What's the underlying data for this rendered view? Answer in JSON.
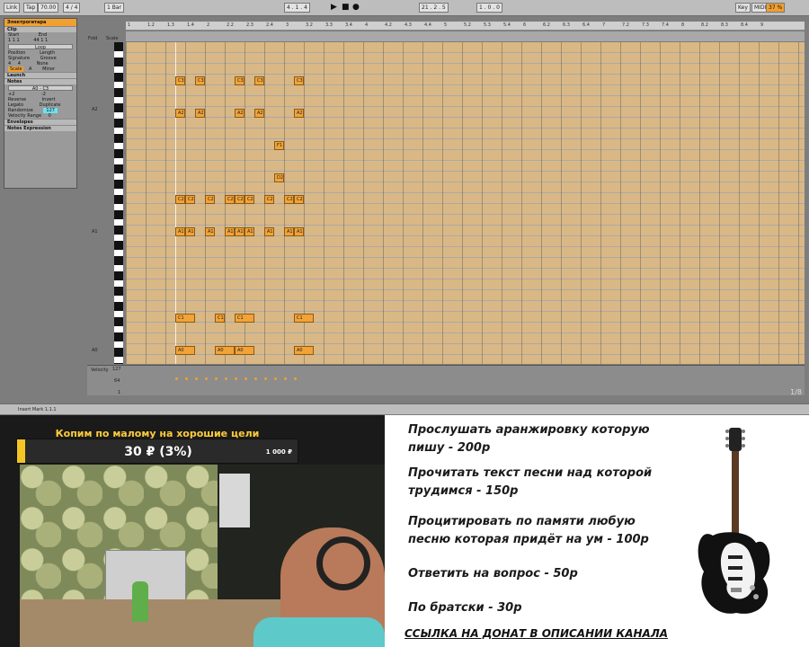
{
  "daw": {
    "transport": {
      "link": "Link",
      "tap": "Tap",
      "tempo": "70.00",
      "time_sig": "4 / 4",
      "quantize": "1 Bar",
      "position": "4 . 1 . 4",
      "loop_start": "21 . 2 . 5",
      "loop_length": "1 . 0 . 0",
      "key": "Key",
      "midi": "MIDI",
      "zoom": "37 %"
    },
    "clip_panel": {
      "clip_name": "Электрогитара",
      "sections": [
        "Clip",
        "Sample",
        "Launch",
        "Notes",
        "Envelopes",
        "Notes Expression"
      ],
      "fields": {
        "start": "Start",
        "end": "End",
        "loop": "Loop",
        "position": "Position",
        "length": "Length",
        "signature": "Signature",
        "groove": "Groove",
        "scale": "Scale",
        "scale_root": "A",
        "scale_mode": "Minor",
        "start_values": "1  1  1",
        "end_values": "44  1  1",
        "sig_num": "4",
        "sig_den": "4",
        "groove_value": "None",
        "note_range": "A0 - C3",
        "transpose_up": "+2",
        "transpose_down": "-2",
        "reverse": "Reverse",
        "invert": "Invert",
        "legato": "Legato",
        "duplicate": "Duplicate",
        "randomize": "Randomize",
        "randomize_value": "127",
        "velocity_range": "Velocity Range",
        "velocity_range_value": "0"
      }
    },
    "ruler_ticks": [
      "1",
      "1.2",
      "1.3",
      "1.4",
      "2",
      "2.2",
      "2.3",
      "2.4",
      "3",
      "3.2",
      "3.3",
      "3.4",
      "4",
      "4.2",
      "4.3",
      "4.4",
      "5",
      "5.2",
      "5.3",
      "5.4",
      "6",
      "6.2",
      "6.3",
      "6.4",
      "7",
      "7.2",
      "7.3",
      "7.4",
      "8",
      "8.2",
      "8.3",
      "8.4",
      "9"
    ],
    "fold_label": "Fold",
    "scale_label": "Scale",
    "octave_labels": [
      "A2",
      "A1",
      "A0"
    ],
    "notes": [
      {
        "label": "C3",
        "col": 0,
        "row": 3,
        "len": 1
      },
      {
        "label": "C3",
        "col": 1,
        "row": 3,
        "len": 1
      },
      {
        "label": "C3",
        "col": 3,
        "row": 3,
        "len": 1
      },
      {
        "label": "C3",
        "col": 4,
        "row": 3,
        "len": 1
      },
      {
        "label": "C3",
        "col": 6,
        "row": 3,
        "len": 1
      },
      {
        "label": "A2",
        "col": 0,
        "row": 6,
        "len": 1
      },
      {
        "label": "A2",
        "col": 1,
        "row": 6,
        "len": 1
      },
      {
        "label": "A2",
        "col": 3,
        "row": 6,
        "len": 1
      },
      {
        "label": "A2",
        "col": 4,
        "row": 6,
        "len": 1
      },
      {
        "label": "A2",
        "col": 6,
        "row": 6,
        "len": 1
      },
      {
        "label": "F1",
        "col": 5,
        "row": 9,
        "len": 1
      },
      {
        "label": "D2",
        "col": 5,
        "row": 12,
        "len": 1
      },
      {
        "label": "C2",
        "col": 0,
        "row": 14,
        "len": 1
      },
      {
        "label": "C2",
        "col": 0.5,
        "row": 14,
        "len": 1
      },
      {
        "label": "C2",
        "col": 1.5,
        "row": 14,
        "len": 1
      },
      {
        "label": "C2",
        "col": 2.5,
        "row": 14,
        "len": 1
      },
      {
        "label": "C2",
        "col": 3,
        "row": 14,
        "len": 1
      },
      {
        "label": "C2",
        "col": 3.5,
        "row": 14,
        "len": 1
      },
      {
        "label": "C2",
        "col": 4.5,
        "row": 14,
        "len": 1
      },
      {
        "label": "C2",
        "col": 5.5,
        "row": 14,
        "len": 1
      },
      {
        "label": "C2",
        "col": 6,
        "row": 14,
        "len": 1
      },
      {
        "label": "A1",
        "col": 0,
        "row": 17,
        "len": 1
      },
      {
        "label": "A1",
        "col": 0.5,
        "row": 17,
        "len": 1
      },
      {
        "label": "A1",
        "col": 1.5,
        "row": 17,
        "len": 1
      },
      {
        "label": "A1",
        "col": 2.5,
        "row": 17,
        "len": 1
      },
      {
        "label": "A1",
        "col": 3,
        "row": 17,
        "len": 1
      },
      {
        "label": "A1",
        "col": 3.5,
        "row": 17,
        "len": 1
      },
      {
        "label": "A1",
        "col": 4.5,
        "row": 17,
        "len": 1
      },
      {
        "label": "A1",
        "col": 5.5,
        "row": 17,
        "len": 1
      },
      {
        "label": "A1",
        "col": 6,
        "row": 17,
        "len": 1
      },
      {
        "label": "C1",
        "col": 0,
        "row": 25,
        "len": 2
      },
      {
        "label": "C1",
        "col": 2,
        "row": 25,
        "len": 1
      },
      {
        "label": "C1",
        "col": 3,
        "row": 25,
        "len": 2
      },
      {
        "label": "C1",
        "col": 6,
        "row": 25,
        "len": 2
      },
      {
        "label": "A0",
        "col": 0,
        "row": 28,
        "len": 2
      },
      {
        "label": "A0",
        "col": 2,
        "row": 28,
        "len": 2
      },
      {
        "label": "A0",
        "col": 3,
        "row": 28,
        "len": 2
      },
      {
        "label": "A0",
        "col": 6,
        "row": 28,
        "len": 2
      }
    ],
    "velocity": {
      "label": "Velocity",
      "max": "127",
      "mid": "64",
      "min": "1"
    },
    "status_text": "Insert Mark 1.1.1",
    "page_indicator": "1/8"
  },
  "donation": {
    "title": "Копим по малому на хорошие цели",
    "amount": "30 ₽ (3%)",
    "target": "1 000 ₽",
    "progress_percent": 3,
    "colors": {
      "fill": "#f5c524",
      "title": "#ffcc3a"
    }
  },
  "price_list": {
    "items": [
      "Прослушать аранжировку которую",
      "пишу - 200р",
      "Прочитать текст песни над которой",
      "трудимся - 150р",
      "Процитировать по памяти любую",
      "песню которая придёт на ум - 100р",
      "Ответить на вопрос - 50р",
      "По братски - 30р"
    ],
    "link_text": "ССЫЛКА НА ДОНАТ В ОПИСАНИИ КАНАЛА"
  }
}
